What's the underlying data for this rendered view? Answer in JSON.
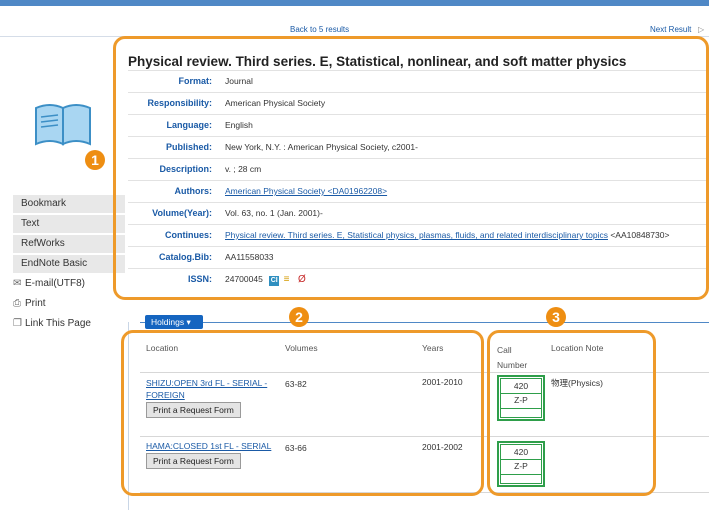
{
  "nav": {
    "back": "Back to 5 results",
    "next": "Next Result",
    "next_icon": "chevron-right"
  },
  "record": {
    "title": "Physical review. Third series. E, Statistical, nonlinear, and soft matter physics",
    "fields": [
      {
        "label": "Format:",
        "value": "Journal"
      },
      {
        "label": "Responsibility:",
        "value": "American Physical Society"
      },
      {
        "label": "Language:",
        "value": "English"
      },
      {
        "label": "Published:",
        "value": "New York, N.Y. : American Physical Society, c2001-"
      },
      {
        "label": "Description:",
        "value": "v. ; 28 cm"
      },
      {
        "label": "Authors:",
        "link": "American Physical Society <DA01962208>"
      },
      {
        "label": "Volume(Year):",
        "value": "Vol. 63, no. 1 (Jan. 2001)-"
      },
      {
        "label": "Continues:",
        "link": "Physical review. Third series. E, Statistical physics, plasmas, fluids, and related interdisciplinary topics",
        "suffix": " <AA10848730>"
      },
      {
        "label": "Catalog.Bib:",
        "value": "AA11558033"
      },
      {
        "label": "ISSN:",
        "value": "24700045"
      }
    ]
  },
  "sidebar": {
    "items": [
      {
        "label": "Bookmark"
      },
      {
        "label": "Text"
      },
      {
        "label": "RefWorks"
      },
      {
        "label": "EndNote Basic"
      },
      {
        "label": "E-mail(UTF8)",
        "icon": "email-icon"
      },
      {
        "label": "Print",
        "icon": "print-icon"
      },
      {
        "label": "Link This Page",
        "icon": "link-icon"
      }
    ]
  },
  "holdings": {
    "button": "Holdings",
    "headers": {
      "location": "Location",
      "volumes": "Volumes",
      "years": "Years",
      "call_number": "Call Number",
      "location_note": "Location Note"
    },
    "rows": [
      {
        "location": "SHIZU:OPEN 3rd FL - SERIAL - FOREIGN",
        "volumes": "63-82",
        "years": "2001-2010",
        "call1": "420",
        "call2": "Z-P",
        "note": "物理(Physics)",
        "request": "Print a Request Form"
      },
      {
        "location": "HAMA:CLOSED 1st FL - SERIAL",
        "volumes": "63-66",
        "years": "2001-2002",
        "call1": "420",
        "call2": "Z-P",
        "note": "",
        "request": "Print a Request Form"
      }
    ]
  },
  "callouts": [
    "1",
    "2",
    "3"
  ],
  "colors": {
    "accent": "#ee9a2a",
    "link": "#1a5aa6",
    "holdings": "#1565c0",
    "callbox": "#2e9e4a"
  }
}
